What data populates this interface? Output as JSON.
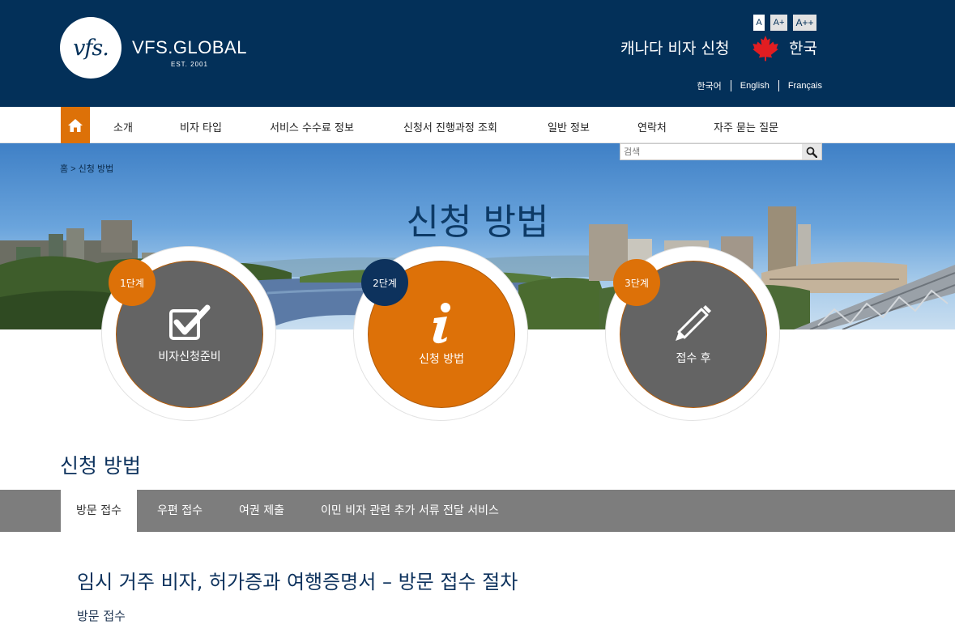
{
  "header": {
    "logo_text": "vfs.",
    "brand": "VFS.GLOBAL",
    "brand_est": "EST. 2001",
    "font_size_buttons": [
      "A",
      "A+",
      "A++"
    ],
    "site_title": "캐나다 비자 신청",
    "country": "한국",
    "languages": [
      "한국어",
      "English",
      "Français"
    ],
    "colors": {
      "primary": "#033059",
      "accent": "#dd7108",
      "flag_red": "#e21d21"
    }
  },
  "nav": {
    "home_icon": "home-icon",
    "items": [
      "소개",
      "비자 타입",
      "서비스 수수료 정보",
      "신청서 진행과정 조회",
      "일반 정보",
      "연락처",
      "자주 묻는 질문"
    ]
  },
  "banner": {
    "breadcrumb": "홈 > 신청 방법",
    "search_placeholder": "검색",
    "title": "신청 방법"
  },
  "steps": [
    {
      "badge": "1단계",
      "label": "비자신청준비",
      "icon": "checkbox-check-icon"
    },
    {
      "badge": "2단계",
      "label": "신청 방법",
      "icon": "info-icon"
    },
    {
      "badge": "3단계",
      "label": "접수 후",
      "icon": "pencil-icon"
    }
  ],
  "section": {
    "title": "신청 방법",
    "tabs": [
      "방문 접수",
      "우편 접수",
      "여권 제출",
      "이민 비자 관련 추가 서류 전달 서비스"
    ],
    "active_tab": "방문 접수",
    "content_title": "임시 거주 비자, 허가증과 여행증명서 – 방문 접수 절차",
    "content_subtitle": "방문 접수"
  }
}
